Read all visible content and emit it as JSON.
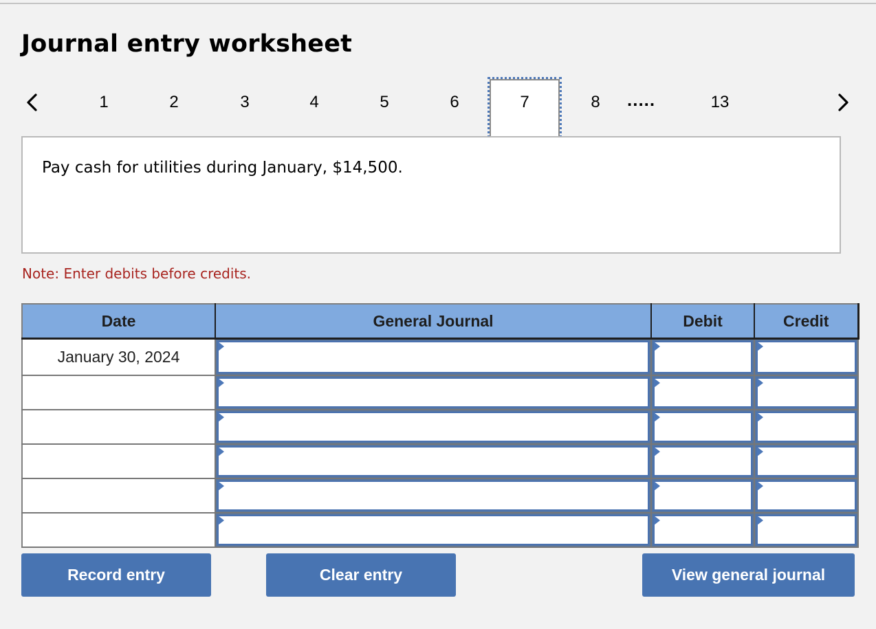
{
  "title": "Journal entry worksheet",
  "pager": {
    "prev_icon": "chevron-left-icon",
    "next_icon": "chevron-right-icon",
    "pages": [
      "1",
      "2",
      "3",
      "4",
      "5",
      "6",
      "7",
      "8"
    ],
    "active_page": "7",
    "ellipsis": ".....",
    "last_page": "13"
  },
  "prompt": "Pay cash for utilities during January, $14,500.",
  "note": "Note: Enter debits before credits.",
  "table": {
    "headers": [
      "Date",
      "General Journal",
      "Debit",
      "Credit"
    ],
    "rows": [
      {
        "date": "January 30, 2024",
        "account": "",
        "debit": "",
        "credit": ""
      },
      {
        "date": "",
        "account": "",
        "debit": "",
        "credit": ""
      },
      {
        "date": "",
        "account": "",
        "debit": "",
        "credit": ""
      },
      {
        "date": "",
        "account": "",
        "debit": "",
        "credit": ""
      },
      {
        "date": "",
        "account": "",
        "debit": "",
        "credit": ""
      },
      {
        "date": "",
        "account": "",
        "debit": "",
        "credit": ""
      }
    ]
  },
  "buttons": {
    "record": "Record entry",
    "clear": "Clear entry",
    "view": "View general journal"
  },
  "colors": {
    "header_bg": "#80aadf",
    "button_bg": "#4874b2",
    "note_text": "#a8241f",
    "active_outline": "#4d78b8"
  }
}
